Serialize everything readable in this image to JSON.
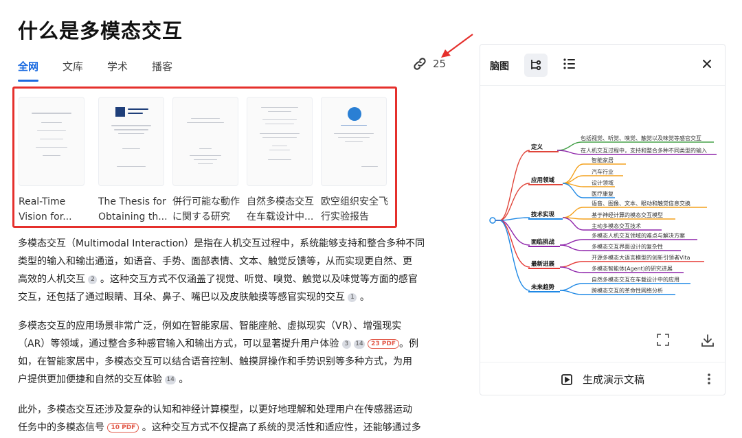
{
  "page": {
    "title": "什么是多模态交互"
  },
  "tabs": [
    "全网",
    "文库",
    "学术",
    "播客"
  ],
  "refs": {
    "count": "25"
  },
  "cards": [
    {
      "title1": "Real-Time",
      "title2": "Vision for..."
    },
    {
      "title1": "The Thesis for",
      "title2": "Obtaining th..."
    },
    {
      "title1": "併行可能な動作",
      "title2": "に関する研究"
    },
    {
      "title1": "自然多模态交互",
      "title2": "在车载设计中..."
    },
    {
      "title1": "欧空组织安全飞",
      "title2": "行实验报告"
    }
  ],
  "p1": {
    "l1": "多模态交互（Multimodal Interaction）是指在人机交互过程中，系统能够支持和整合多种不同",
    "l2": "类型的输入和输出通道，如语音、手势、面部表情、文本、触觉反馈等，从而实现更自然、更",
    "l3a": "高效的人机交互",
    "b1": "2",
    "l3b": "。这种交互方式不仅涵盖了视觉、听觉、嗅觉、触觉以及味觉等方面的感官",
    "l4a": "交互，还包括了通过眼睛、耳朵、鼻子、嘴巴以及皮肤触摸等感官实现的交互",
    "b2": "1",
    "l4b": "。"
  },
  "p2": {
    "l1": "多模态交互的应用场景非常广泛，例如在智能家居、智能座舱、虚拟现实（VR）、增强现实",
    "l2a": "（AR）等领域，通过整合多种感官输入和输出方式，可以显著提升用户体验",
    "b1": "3",
    "b2": "14",
    "pdf": "23 PDF",
    "l2b": "。例",
    "l3": "如，在智能家居中，多模态交互可以结合语音控制、触摸屏操作和手势识别等多种方式，为用",
    "l4a": "户提供更加便捷和自然的交互体验",
    "b3": "14",
    "l4b": "。"
  },
  "p3": {
    "l1": "此外，多模态交互还涉及复杂的认知和神经计算模型，以更好地理解和处理用户在传感器运动",
    "l2a": "任务中的多模态信号",
    "pdf": "10 PDF",
    "l2b": "。这种交互方式不仅提高了系统的灵活性和适应性，还能够通过多"
  },
  "panel": {
    "label": "脑图",
    "generate": "生成演示文稿",
    "mindmap": {
      "b1": "定义",
      "b1l1": "包括视觉、听觉、嗅觉、触觉以及味觉等感官交互",
      "b1l2": "在人机交互过程中，支持和整合多种不同类型的输入",
      "b2": "应用领域",
      "b2l1": "智能家居",
      "b2l2": "汽车行业",
      "b2l3": "设计领域",
      "b2l4": "医疗康复",
      "b3": "技术实现",
      "b3l1": "语音、图像、文本、眼动和触觉信息交换",
      "b3l2": "基于神经计算的模态交互模型",
      "b3l3": "主动多模态交互技术",
      "b4": "面临挑战",
      "b4l1": "多模态人机交互领域的难点与解决方案",
      "b4l2": "多模态交互界面设计的复杂性",
      "b5": "最新进展",
      "b5l1": "开源多模态大语言模型的创新引领者Vita",
      "b5l2": "多模态智能体(Agent)的研究进展",
      "b6": "未来趋势",
      "b6l1": "自然多模态交互在车载设计中的应用",
      "b6l2": "跨模态交互的革命性网络分析"
    }
  },
  "colors": {
    "accent": "#1a6ae0",
    "highlight": "#e5302c"
  }
}
